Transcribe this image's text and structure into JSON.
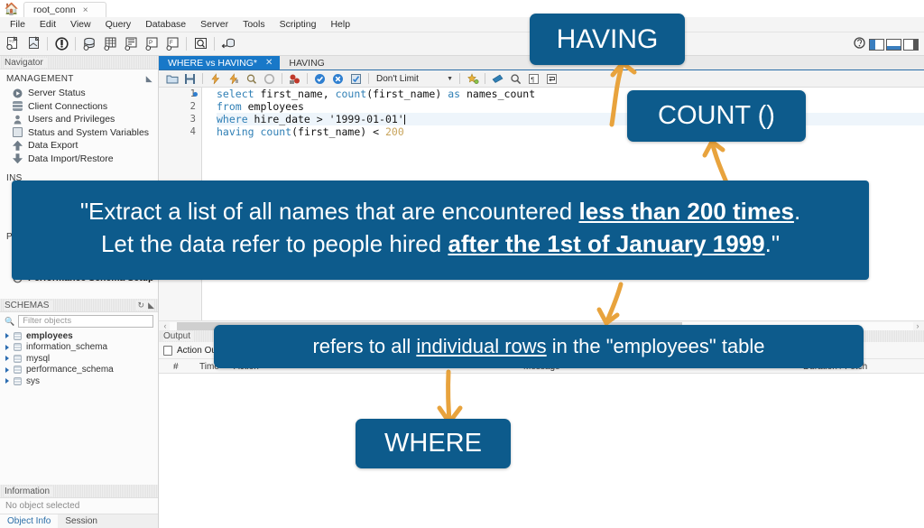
{
  "window": {
    "home_icon": "home-icon",
    "connection_tab": "root_conn",
    "close_label": "×"
  },
  "menubar": {
    "items": [
      "File",
      "Edit",
      "View",
      "Query",
      "Database",
      "Server",
      "Tools",
      "Scripting",
      "Help"
    ]
  },
  "toolbar": {
    "icons": [
      "new-sql-tab-icon",
      "open-sql-script-icon",
      "open-connection-icon",
      "new-schema-icon",
      "new-table-icon",
      "new-view-icon",
      "new-procedure-icon",
      "new-function-icon",
      "inspect-icon",
      "reconnect-icon"
    ],
    "help_icon": "help-icon",
    "panel_toggles": [
      "toggle-sidebar-icon",
      "toggle-output-icon",
      "toggle-secondary-sidebar-icon"
    ]
  },
  "navigator": {
    "title": "Navigator",
    "expand_icon": "expand-icon",
    "management": {
      "title": "MANAGEMENT",
      "items": [
        {
          "label": "Server Status",
          "icon": "server-status-icon"
        },
        {
          "label": "Client Connections",
          "icon": "client-connections-icon"
        },
        {
          "label": "Users and Privileges",
          "icon": "users-privileges-icon"
        },
        {
          "label": "Status and System Variables",
          "icon": "status-variables-icon"
        },
        {
          "label": "Data Export",
          "icon": "data-export-icon"
        },
        {
          "label": "Data Import/Restore",
          "icon": "data-import-icon"
        }
      ]
    },
    "instance": {
      "title": "INS"
    },
    "performance": {
      "title": "PE",
      "last_item": "Performance Schema Setup"
    },
    "schemas": {
      "title": "SCHEMAS",
      "refresh_icon": "refresh-icon",
      "expand_icon": "expand-icon",
      "filter_placeholder": "Filter objects",
      "search_icon": "search-icon",
      "items": [
        {
          "label": "employees",
          "bold": true
        },
        {
          "label": "information_schema",
          "bold": false
        },
        {
          "label": "mysql",
          "bold": false
        },
        {
          "label": "performance_schema",
          "bold": false
        },
        {
          "label": "sys",
          "bold": false
        }
      ]
    },
    "information": {
      "title": "Information",
      "body": "No object selected",
      "tabs": [
        "Object Info",
        "Session"
      ],
      "active_tab": "Object Info"
    }
  },
  "editor": {
    "tabs": [
      {
        "label": "WHERE vs HAVING*",
        "active": true,
        "closable": true
      },
      {
        "label": "HAVING",
        "active": false,
        "closable": false
      }
    ],
    "sql_toolbar": {
      "icons": [
        "open-script-icon",
        "save-script-icon",
        "execute-icon",
        "execute-current-icon",
        "explain-icon",
        "stop-icon",
        "toggle-stop-on-error-icon",
        "commit-icon",
        "rollback-icon",
        "autocommit-icon"
      ],
      "limit_value": "Don't Limit",
      "right_icons": [
        "beautify-icon",
        "find-icon",
        "zoom-icon",
        "toggle-invisible-chars-icon",
        "wrap-lines-icon"
      ]
    },
    "code": {
      "lines": [
        {
          "n": "1",
          "marker": true,
          "current": false,
          "tokens": [
            {
              "t": "select",
              "c": "kw"
            },
            {
              "t": " first_name, ",
              "c": "plain"
            },
            {
              "t": "count",
              "c": "fn"
            },
            {
              "t": "(first_name) ",
              "c": "plain"
            },
            {
              "t": "as",
              "c": "kw"
            },
            {
              "t": " names_count",
              "c": "plain"
            }
          ]
        },
        {
          "n": "2",
          "marker": false,
          "current": false,
          "tokens": [
            {
              "t": "from",
              "c": "kw"
            },
            {
              "t": " employees",
              "c": "plain"
            }
          ]
        },
        {
          "n": "3",
          "marker": false,
          "current": true,
          "tokens": [
            {
              "t": "where",
              "c": "kw"
            },
            {
              "t": " hire_date > ",
              "c": "plain"
            },
            {
              "t": "'1999-01-01'",
              "c": "str"
            }
          ]
        },
        {
          "n": "4",
          "marker": false,
          "current": false,
          "tokens": [
            {
              "t": "having",
              "c": "kw"
            },
            {
              "t": " ",
              "c": "plain"
            },
            {
              "t": "count",
              "c": "fn"
            },
            {
              "t": "(first_name) < ",
              "c": "plain"
            },
            {
              "t": "200",
              "c": "num"
            }
          ]
        }
      ]
    }
  },
  "output": {
    "title": "Output",
    "mode": "Action Output",
    "columns": [
      "#",
      "Time",
      "Action",
      "Message",
      "Duration / Fetch"
    ]
  },
  "annotations": {
    "having": "HAVING",
    "count": "COUNT ()",
    "where": "WHERE",
    "rows_note_prefix": "refers to all ",
    "rows_note_underline": "individual rows",
    "rows_note_suffix": " in the \"employees\" table",
    "task_line1_a": "\"Extract a list of all names that are encountered ",
    "task_line1_u": "less than 200 times",
    "task_line1_b": ".",
    "task_line2_a": "Let the data refer to people hired ",
    "task_line2_u": "after the 1st of January 1999",
    "task_line2_b": ".\""
  },
  "colors": {
    "callout_blue": "#0d5b8c",
    "arrow_orange": "#e8a33d",
    "tab_active_blue": "#1878c8",
    "sql_keyword": "#2f7fb5",
    "sql_number": "#c8a45b"
  }
}
